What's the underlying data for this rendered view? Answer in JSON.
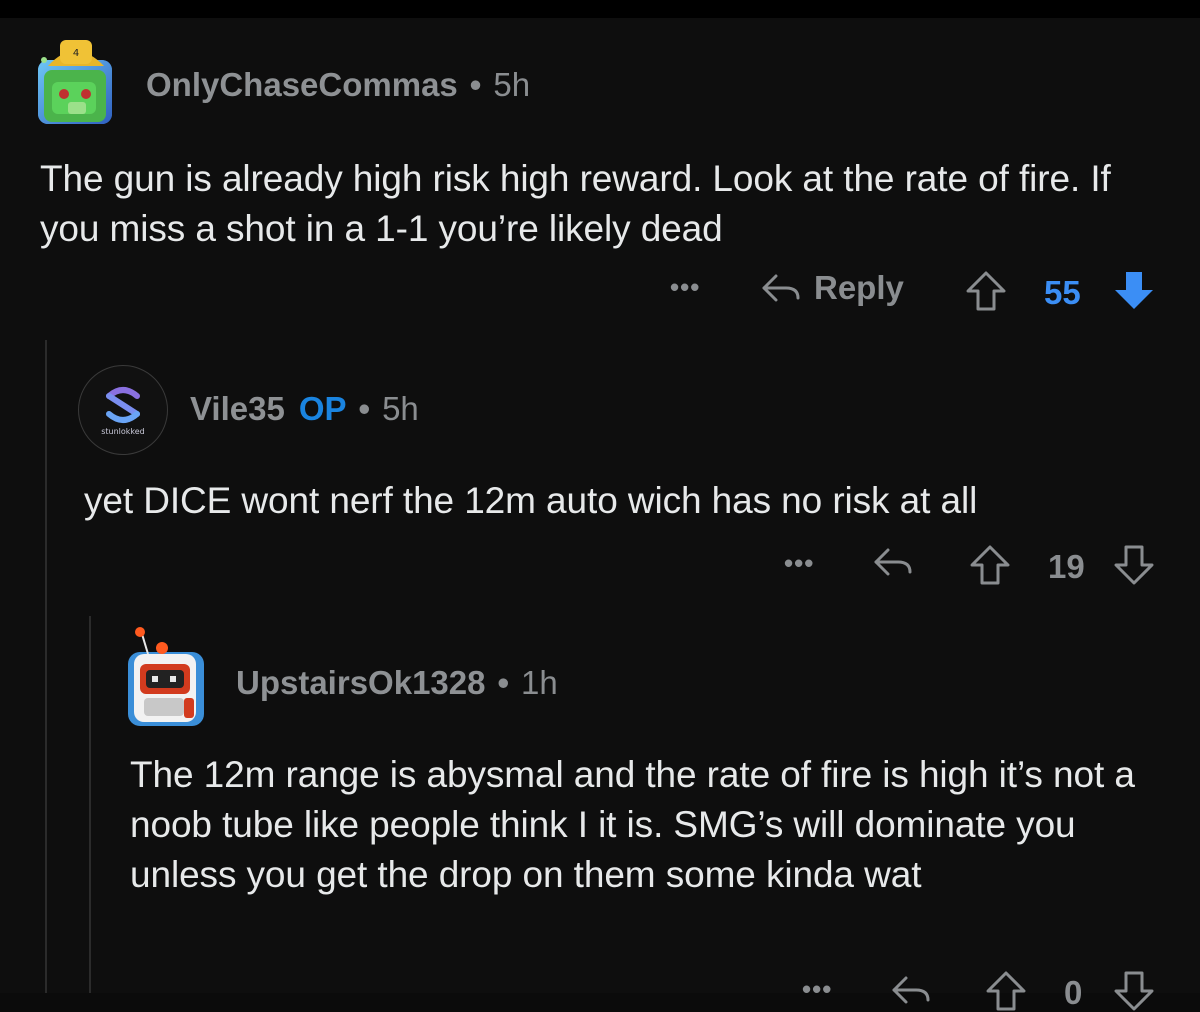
{
  "comments": [
    {
      "username": "OnlyChaseCommas",
      "op_badge": "",
      "separator": "•",
      "age": "5h",
      "text": "The gun is already high risk high reward. Look at the rate of fire. If you miss a shot in a 1-1 you’re likely dead",
      "more_label": "•••",
      "reply_label": "Reply",
      "score": "55",
      "vote_state": "downvoted",
      "accent_color": "#3b8ef5"
    },
    {
      "username": "Vile35",
      "op_badge": "OP",
      "separator": "•",
      "age": "5h",
      "avatar_caption": "stunlokked",
      "text": "yet DICE wont nerf the 12m auto wich has no risk at all",
      "more_label": "•••",
      "score": "19",
      "op_color": "#1a84e0"
    },
    {
      "username": "UpstairsOk1328",
      "op_badge": "",
      "separator": "•",
      "age": "1h",
      "text": "The 12m range is abysmal and the rate of fire is high it’s not a noob tube like people think I it is. SMG’s will dominate you unless you get the drop on them some kinda wat",
      "more_label": "•••",
      "score": "0"
    }
  ]
}
